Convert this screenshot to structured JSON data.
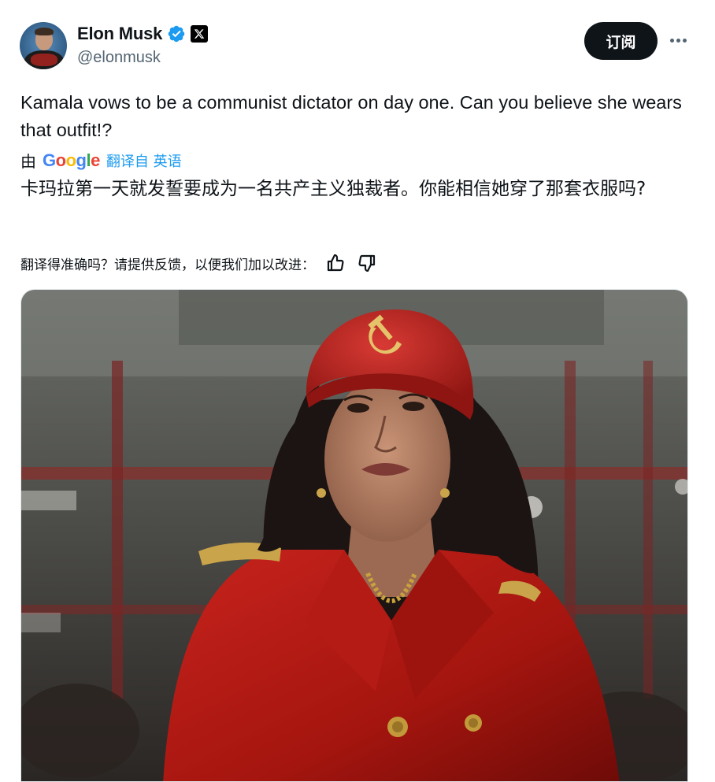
{
  "author": {
    "display_name": "Elon Musk",
    "handle": "@elonmusk",
    "verified_icon": "verified-badge-icon",
    "affiliation_icon": "x-logo-icon"
  },
  "actions": {
    "subscribe_label": "订阅",
    "more_icon": "more-horizontal-icon"
  },
  "tweet": {
    "text": "Kamala vows to be a communist dictator on day one. Can you believe she wears that outfit!?"
  },
  "translation": {
    "by_label": "由",
    "provider": "Google",
    "from_label": "翻译自 英语",
    "text": "卡玛拉第一天就发誓要成为一名共产主义独裁者。你能相信她穿了那套衣服吗?",
    "feedback_prompt": "翻译得准确吗？请提供反馈，以便我们加以改进：",
    "thumbs_up_icon": "thumbs-up-icon",
    "thumbs_down_icon": "thumbs-down-icon"
  },
  "media": {
    "type": "image",
    "subject": "woman-in-red-military-coat-and-cap"
  },
  "colors": {
    "accent": "#1d9bf0",
    "text": "#0f1419",
    "secondary_text": "#536471",
    "button_bg": "#0f1419"
  }
}
